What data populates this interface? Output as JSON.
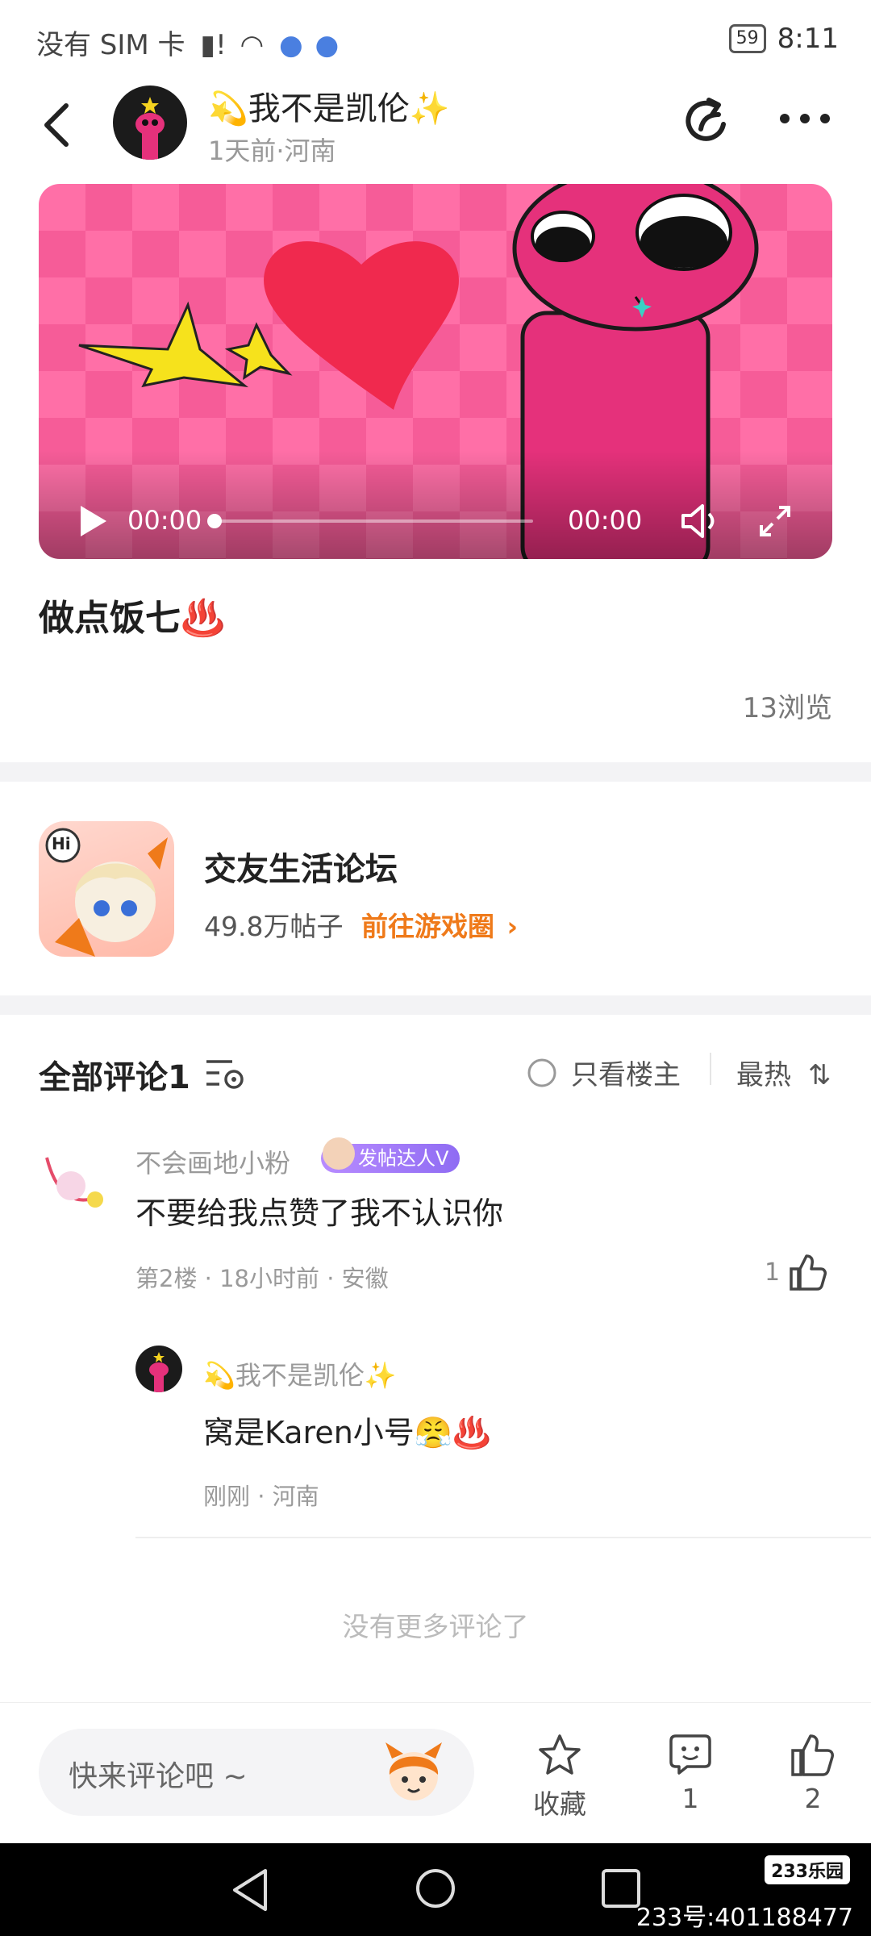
{
  "status_bar": {
    "carrier": "没有 SIM 卡",
    "battery": "59",
    "time": "8:11"
  },
  "header": {
    "author_name": "💫我不是凯伦✨",
    "author_meta": "1天前·河南",
    "icons": [
      "back-icon",
      "share-icon",
      "more-icon"
    ]
  },
  "video": {
    "current_time": "00:00",
    "duration": "00:00",
    "progress": 0,
    "icons": [
      "play-icon",
      "volume-icon",
      "fullscreen-icon"
    ]
  },
  "post": {
    "title": "做点饭七♨️",
    "views": "13浏览"
  },
  "forum": {
    "name": "交友生活论坛",
    "post_count": "49.8万帖子",
    "link_label": "前往游戏圈",
    "icon_badge": "Hi"
  },
  "comments": {
    "title": "全部评论1",
    "only_host_label": "只看楼主",
    "sort_label": "最热",
    "items": [
      {
        "name": "不会画地小粉",
        "badge": "发帖达人V",
        "text": "不要给我点赞了我不认识你",
        "meta": "第2楼 · 18小时前 · 安徽",
        "likes": "1",
        "reply": {
          "name": "💫我不是凯伦✨",
          "text": "窝是Karen小号😤♨️",
          "meta": "刚刚 · 河南"
        }
      }
    ],
    "no_more": "没有更多评论了"
  },
  "bottom_bar": {
    "input_placeholder": "快来评论吧 ~",
    "favorite_label": "收藏",
    "comment_count": "1",
    "like_count": "2"
  },
  "watermark": {
    "logo": "233乐园",
    "text": "233号:401188477"
  },
  "colors": {
    "accent_orange": "#ef7a1a",
    "badge_purple": "#9b74f5",
    "video_pink": "#ff6fa7"
  }
}
